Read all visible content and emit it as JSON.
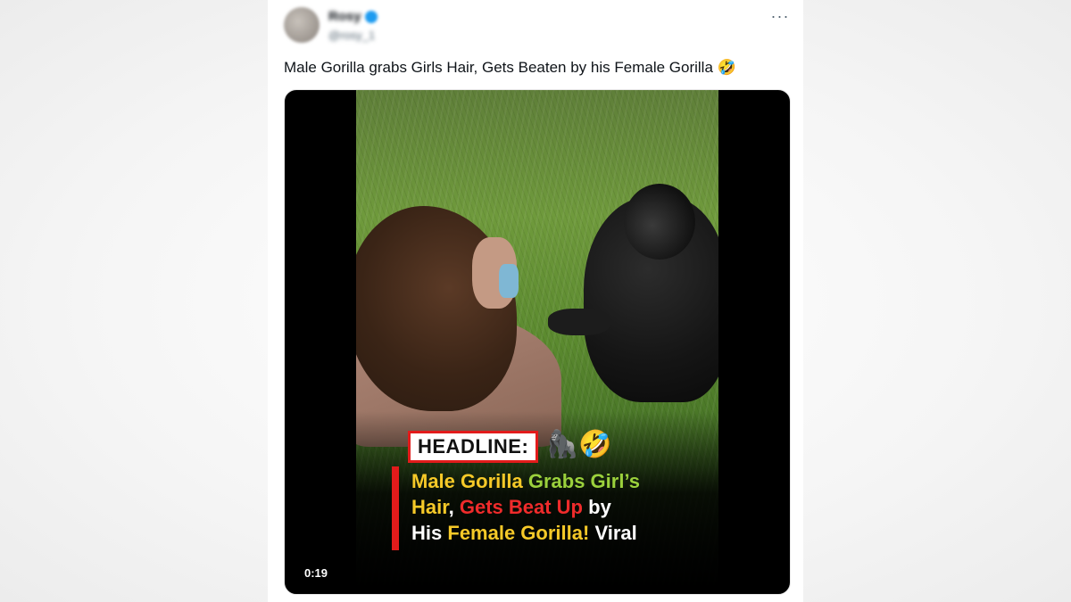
{
  "tweet": {
    "author_name": "Rosy",
    "author_handle": "@rosy_1",
    "more_label": "···",
    "text": "Male Gorilla grabs Girls Hair, Gets Beaten by his Female Gorilla 🤣"
  },
  "video": {
    "headline_label": "HEADLINE:",
    "headline_emoji": "🦍🤣",
    "caption_parts": {
      "p1": "Male Gorilla",
      "p2": "Grabs Girl’s",
      "p3": "Hair",
      "p4": ",",
      "p5": "Gets Beat Up",
      "p6": "by",
      "p7": "His",
      "p8": "Female Gorilla!",
      "p9": "Viral"
    },
    "timestamp": "0:19"
  },
  "colors": {
    "accent_red": "#e21b1b",
    "caption_yellow": "#f6c928",
    "caption_green": "#9bd13c",
    "caption_red": "#ef2b2b",
    "verified_blue": "#1d9bf0"
  }
}
